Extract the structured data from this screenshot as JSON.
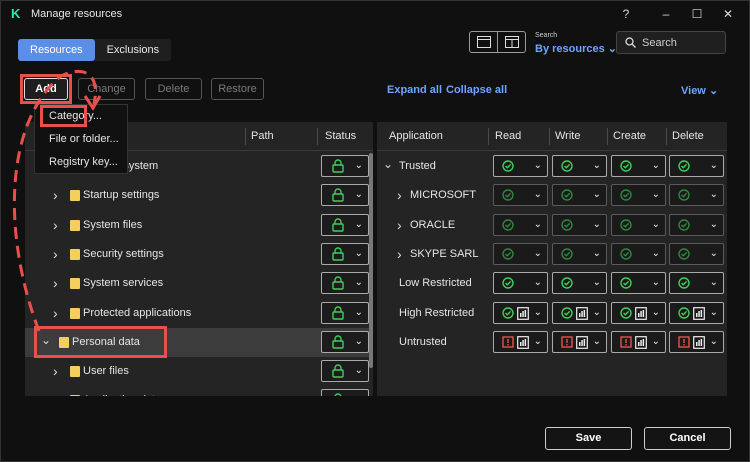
{
  "window": {
    "title": "Manage resources",
    "logo": "K",
    "buttons": {
      "help": "?",
      "minimize": "–",
      "maximize": "☐",
      "close": "✕"
    }
  },
  "tabs": [
    {
      "label": "Resources",
      "active": true
    },
    {
      "label": "Exclusions",
      "active": false
    }
  ],
  "search": {
    "label": "Search",
    "by": "By resources",
    "placeholder": "Search"
  },
  "toolbar": {
    "add": "Add",
    "change": "Change",
    "delete": "Delete",
    "restore": "Restore",
    "expand_all": "Expand all",
    "collapse_all": "Collapse all",
    "view": "View"
  },
  "add_menu": {
    "items": [
      "Category...",
      "File or folder...",
      "Registry key..."
    ]
  },
  "resources_table": {
    "columns": {
      "path": "Path",
      "status": "Status"
    },
    "rows": [
      {
        "label": "Operating system"
      },
      {
        "label": "Startup settings"
      },
      {
        "label": "System files"
      },
      {
        "label": "Security settings"
      },
      {
        "label": "System services"
      },
      {
        "label": "Protected applications"
      },
      {
        "label": "Personal data"
      },
      {
        "label": "User files"
      },
      {
        "label": "Application data"
      }
    ]
  },
  "applications_table": {
    "columns": {
      "application": "Application",
      "read": "Read",
      "write": "Write",
      "create": "Create",
      "delete": "Delete"
    },
    "rows": [
      {
        "label": "Trusted",
        "perm": "allow"
      },
      {
        "label": "MICROSOFT",
        "perm": "allow-inherited"
      },
      {
        "label": "ORACLE",
        "perm": "allow-inherited"
      },
      {
        "label": "SKYPE SARL",
        "perm": "allow-inherited"
      },
      {
        "label": "Low Restricted",
        "perm": "allow"
      },
      {
        "label": "High Restricted",
        "perm": "allow-log"
      },
      {
        "label": "Untrusted",
        "perm": "deny-log"
      }
    ]
  },
  "footer": {
    "save": "Save",
    "cancel": "Cancel"
  },
  "colors": {
    "accent": "#5b8ee6",
    "link": "#6fa4ff",
    "allow": "#3ecf5a",
    "deny": "#e8504c",
    "folder": "#f4cf5c",
    "annotation": "#e8504c"
  }
}
